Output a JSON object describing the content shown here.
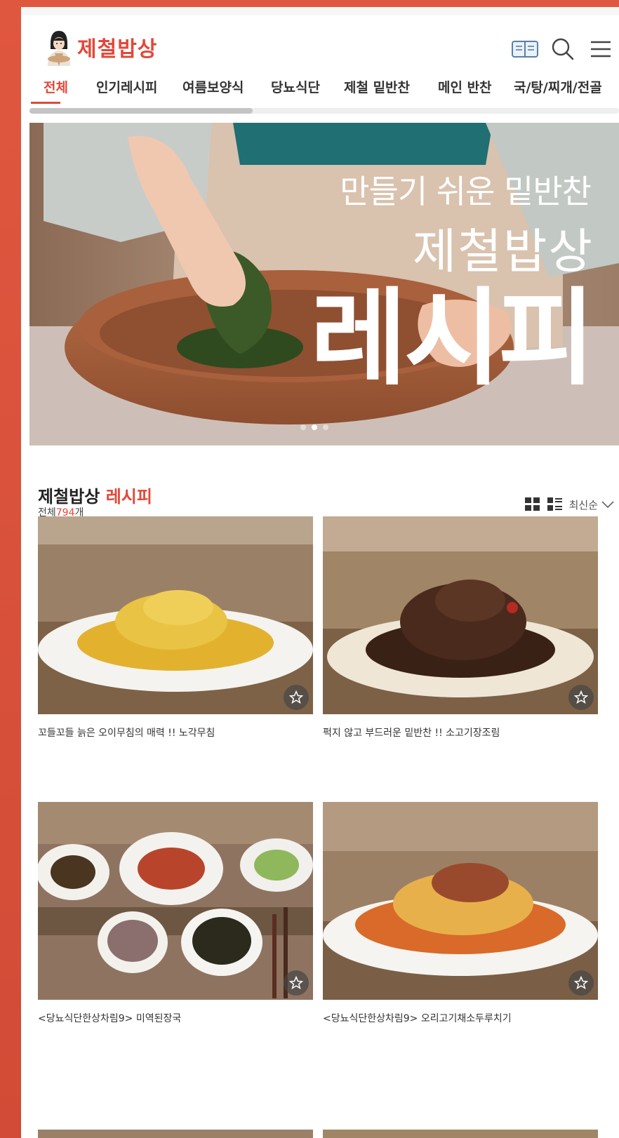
{
  "app": {
    "name": "제철밥상"
  },
  "header": {
    "icons": [
      "book-icon",
      "search-icon",
      "menu-icon"
    ]
  },
  "nav": {
    "tabs": [
      {
        "label": "전체",
        "active": true
      },
      {
        "label": "인기레시피"
      },
      {
        "label": "여름보양식"
      },
      {
        "label": "당뇨식단"
      },
      {
        "label": "제철 밑반찬"
      },
      {
        "label": "메인 반찬"
      },
      {
        "label": "국/탕/찌개/전골"
      }
    ]
  },
  "hero": {
    "line1": "만들기 쉬운 밑반찬",
    "line2": "제철밥상",
    "line3": "레시피",
    "slide_count": 3,
    "active_slide": 2
  },
  "section": {
    "title_main": "제철밥상",
    "title_accent": "레시피",
    "count_prefix": "전체",
    "count_value": "794",
    "count_suffix": "개",
    "sort_label": "최신순"
  },
  "recipes": [
    {
      "title": "꼬들꼬들 늙은 오이무침의 매력 !! 노각무침",
      "icon": "star-icon"
    },
    {
      "title": "퍽지 않고 부드러운 밑반찬 !! 소고기장조림",
      "icon": "star-icon"
    },
    {
      "title": "<당뇨식단한상차림9> 미역된장국",
      "icon": "star-icon"
    },
    {
      "title": "<당뇨식단한상차림9> 오리고기채소두루치기",
      "icon": "star-icon"
    }
  ],
  "colors": {
    "accent": "#e2483a",
    "frame": "#d9553f"
  }
}
